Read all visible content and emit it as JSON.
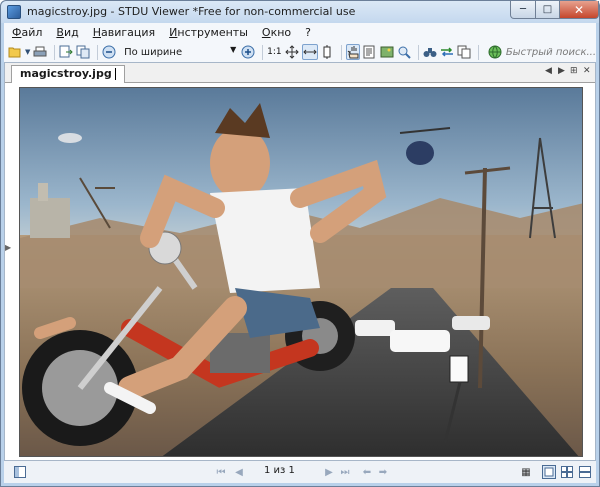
{
  "window": {
    "title": "magicstroy.jpg - STDU Viewer *Free for non-commercial use",
    "icons": {
      "app": "app-icon",
      "minimize": "minimize-icon",
      "maximize": "maximize-icon",
      "close": "close-icon"
    }
  },
  "menubar": {
    "items": [
      "Файл",
      "Вид",
      "Навигация",
      "Инструменты",
      "Окно",
      "?"
    ]
  },
  "toolbar": {
    "zoom_mode": "По ширине",
    "actual_size_label": "1:1",
    "search_placeholder": "Быстрый поиск..."
  },
  "tabs": {
    "active": "magicstroy.jpg"
  },
  "document": {
    "image_file": "magicstroy.jpg"
  },
  "statusbar": {
    "page_indicator": "1 из 1"
  }
}
